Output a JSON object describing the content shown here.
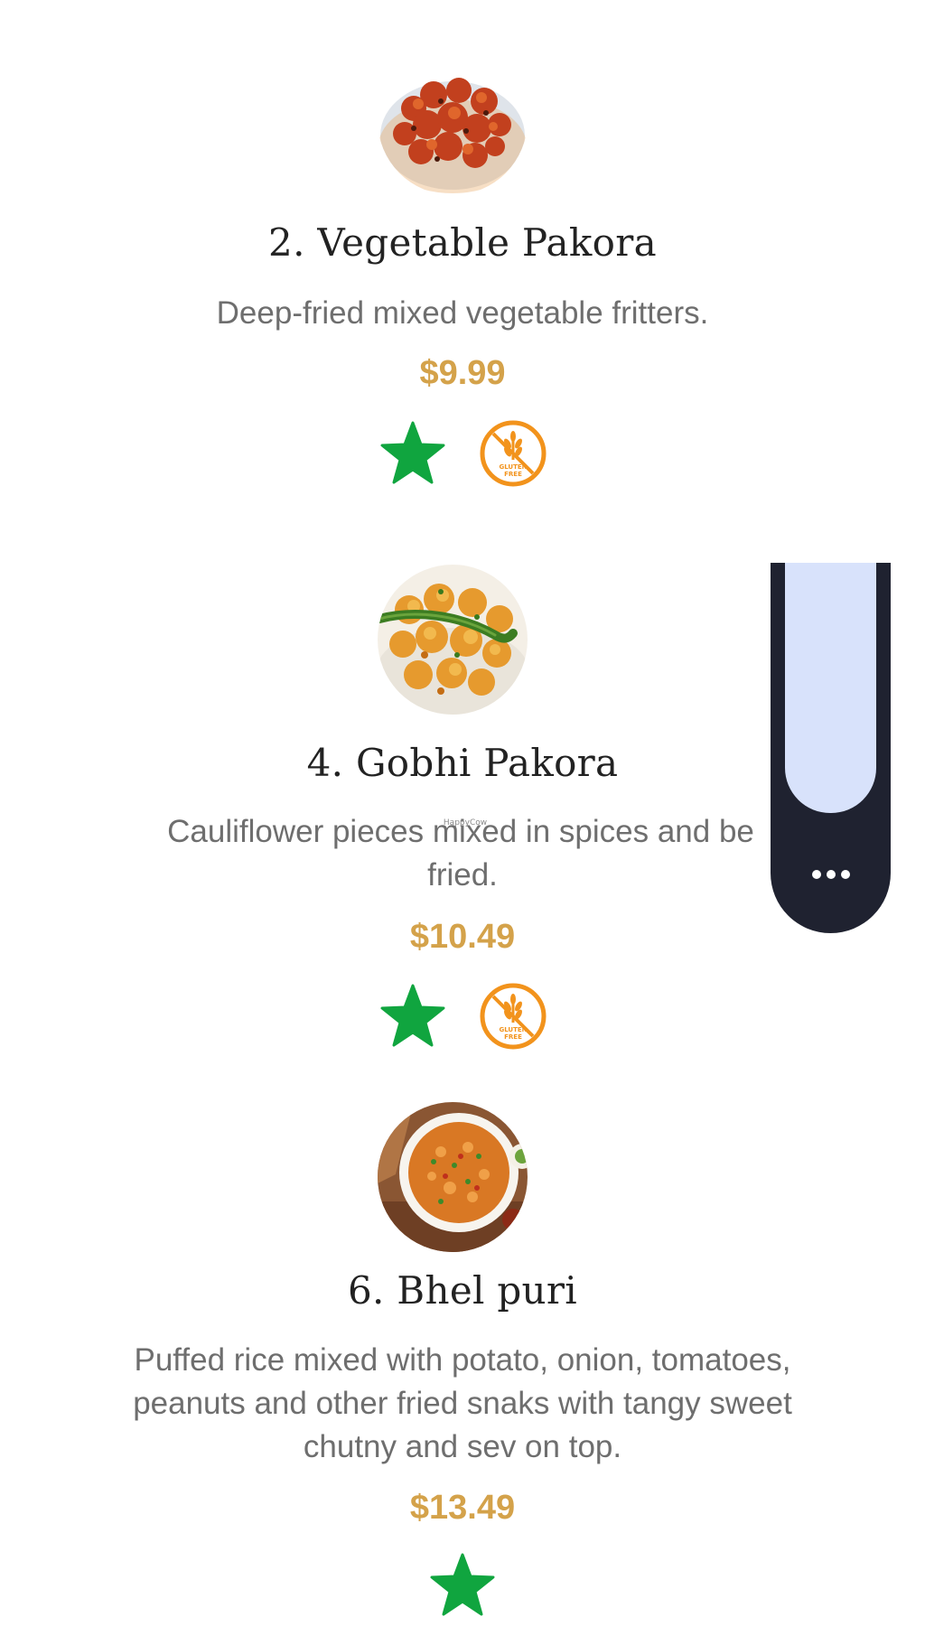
{
  "menu": {
    "items": [
      {
        "title": "2. Vegetable Pakora",
        "description": "Deep-fried mixed vegetable fritters.",
        "price": "$9.99",
        "photo": "vegetable-pakora-photo",
        "badges": [
          "vegetarian-star-icon",
          "gluten-free-icon"
        ]
      },
      {
        "title": "4. Gobhi Pakora",
        "description": "Cauliflower pieces mixed in spices and be",
        "description_line2": "fried.",
        "price": "$10.49",
        "photo": "gobhi-pakora-photo",
        "badges": [
          "vegetarian-star-icon",
          "gluten-free-icon"
        ]
      },
      {
        "title": "6. Bhel puri",
        "description": "Puffed rice mixed with potato, onion, tomatoes, peanuts and other fried snaks with tangy sweet chutny and sev on top.",
        "price": "$13.49",
        "photo": "bhel-puri-photo",
        "badges": [
          "vegetarian-star-icon"
        ]
      }
    ],
    "gluten_free_badge_text": [
      "GLUTEN",
      "FREE"
    ],
    "watermark": "HappyCow"
  },
  "side_widget": {
    "more_icon": "more-dots-icon"
  },
  "colors": {
    "price": "#d4a24a",
    "star": "#10a53f",
    "gluten_free": "#f2931c",
    "widget_dark": "#1f2230",
    "widget_light": "#d8e2fb"
  }
}
